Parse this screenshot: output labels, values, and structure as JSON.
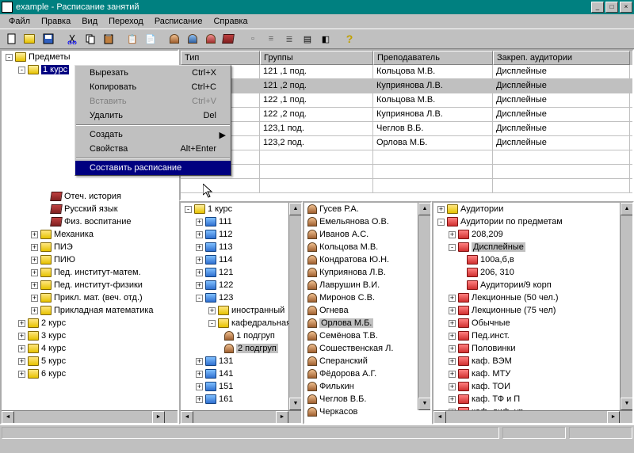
{
  "title": "example - Расписание занятий",
  "menus": [
    "Файл",
    "Правка",
    "Вид",
    "Переход",
    "Расписание",
    "Справка"
  ],
  "ctx": {
    "items": [
      {
        "label": "Вырезать",
        "sc": "Ctrl+X",
        "enabled": true
      },
      {
        "label": "Копировать",
        "sc": "Ctrl+C",
        "enabled": true
      },
      {
        "label": "Вставить",
        "sc": "Ctrl+V",
        "enabled": false
      },
      {
        "label": "Удалить",
        "sc": "Del",
        "enabled": true
      }
    ],
    "items2": [
      {
        "label": "Создать",
        "sub": true,
        "enabled": true
      },
      {
        "label": "Свойства",
        "sc": "Alt+Enter",
        "enabled": true
      }
    ],
    "highlight": "Составить расписание"
  },
  "left_tree": {
    "root": "Предметы",
    "kurs1": "1 курс",
    "books": [
      "Отеч. история",
      "Русский язык",
      "Физ. воспитание"
    ],
    "folders": [
      "Механика",
      "ПИЭ",
      "ПИЮ",
      "Пед. институт-матем.",
      "Пед. институт-физики",
      "Прикл. мат. (веч. отд.)",
      "Прикладная математика"
    ],
    "kurs": [
      "2 курс",
      "3 курс",
      "4 курс",
      "5 курс",
      "6 курс"
    ]
  },
  "grid": {
    "headers": [
      "Тип",
      "Группы",
      "Преподаватель",
      "Закреп. аудитории"
    ],
    "widths": [
      100,
      143,
      151,
      173
    ],
    "rows": [
      {
        "g": "121 ,1 под.",
        "t": "Кольцова М.В.",
        "a": "Дисплейные"
      },
      {
        "g": "121 ,2 под.",
        "t": "Куприянова Л.В.",
        "a": "Дисплейные",
        "sel": true
      },
      {
        "g": "122 ,1 под.",
        "t": "Кольцова М.В.",
        "a": "Дисплейные"
      },
      {
        "g": "122 ,2 под.",
        "t": "Куприянова Л.В.",
        "a": "Дисплейные"
      },
      {
        "g": "123,1 под.",
        "t": "Чеглов В.Б.",
        "a": "Дисплейные"
      },
      {
        "g": "123,2 под.",
        "t": "Орлова М.Б.",
        "a": "Дисплейные"
      }
    ]
  },
  "p1": {
    "root": "1 курс",
    "items": [
      "111",
      "112",
      "113",
      "114",
      "121",
      "122"
    ],
    "g123": "123",
    "sub123": [
      "иностранный",
      "кафедральная"
    ],
    "pod": [
      "1 подгруп",
      "2 подгруп"
    ],
    "more": [
      "131",
      "141",
      "151",
      "161"
    ]
  },
  "p2": [
    "Гусев Р.А.",
    "Емельянова О.В.",
    "Иванов А.С.",
    "Кольцова М.В.",
    "Кондратова Ю.Н.",
    "Куприянова Л.В.",
    "Лаврушин В.И.",
    "Миронов С.В.",
    "Огнева",
    "Орлова М.Б.",
    "Семёнова Т.В.",
    "Сошественская Л.",
    "Сперанский",
    "Фёдорова А.Г.",
    "Филькин",
    "Чеглов В.Б.",
    "Черкасов"
  ],
  "p2_sel": "Орлова М.Б.",
  "p3": {
    "root": "Аудитории",
    "sub": "Аудитории по предметам",
    "r1": "208,209",
    "disp": "Дисплейные",
    "disp_items": [
      "100а,б,в",
      "206, 310",
      "Аудитории/9 корп"
    ],
    "rest": [
      "Лекционные (50 чел.)",
      "Лекционные (75 чел)",
      "Обычные",
      "Пед.инст.",
      "Половинки",
      "каф. ВЭМ",
      "каф. МТУ",
      "каф. ТОИ",
      "каф. ТФ и П",
      "каф. диф. ур"
    ]
  }
}
